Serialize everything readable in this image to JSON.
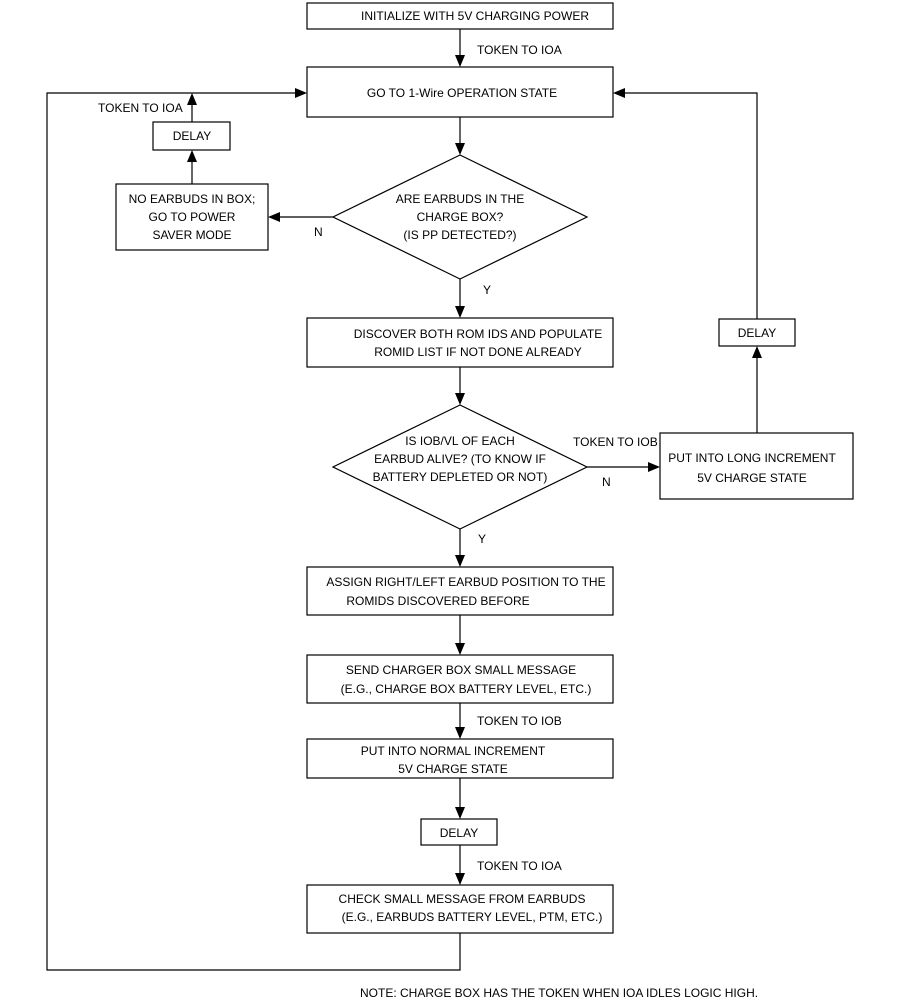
{
  "nodes": {
    "init": {
      "lines": [
        "INITIALIZE WITH 5V CHARGING POWER"
      ]
    },
    "one_wire": {
      "lines": [
        "GO TO 1-Wire OPERATION STATE"
      ]
    },
    "decision_earbuds": {
      "lines": [
        "ARE EARBUDS IN THE",
        "CHARGE BOX?",
        "(IS PP DETECTED?)"
      ]
    },
    "power_saver": {
      "lines": [
        "NO EARBUDS IN BOX;",
        "GO TO POWER",
        "SAVER MODE"
      ]
    },
    "delay_left": {
      "lines": [
        "DELAY"
      ]
    },
    "discover": {
      "lines": [
        "DISCOVER BOTH ROM IDS AND POPULATE",
        "ROMID LIST IF NOT DONE ALREADY"
      ]
    },
    "decision_alive": {
      "lines": [
        "IS IOB/VL OF EACH",
        "EARBUD ALIVE? (TO KNOW IF",
        "BATTERY DEPLETED OR NOT)"
      ]
    },
    "long_increment": {
      "lines": [
        "PUT INTO LONG INCREMENT",
        "5V CHARGE STATE"
      ]
    },
    "delay_right": {
      "lines": [
        "DELAY"
      ]
    },
    "assign": {
      "lines": [
        "ASSIGN RIGHT/LEFT EARBUD POSITION TO THE",
        "ROMIDS DISCOVERED BEFORE"
      ]
    },
    "send_msg": {
      "lines": [
        "SEND CHARGER BOX SMALL MESSAGE",
        "(E.G., CHARGE BOX BATTERY LEVEL, ETC.)"
      ]
    },
    "normal_increment": {
      "lines": [
        "PUT INTO NORMAL INCREMENT",
        "5V CHARGE STATE"
      ]
    },
    "delay_bottom": {
      "lines": [
        "DELAY"
      ]
    },
    "check_msg": {
      "lines": [
        "CHECK SMALL MESSAGE FROM EARBUDS",
        "(E.G., EARBUDS BATTERY LEVEL, PTM, ETC.)"
      ]
    }
  },
  "edge_labels": {
    "init_to_onewire": "TOKEN TO IOA",
    "delay_left_up": "TOKEN TO IOA",
    "earbuds_no": "N",
    "earbuds_yes": "Y",
    "alive_no_token": "TOKEN TO IOB",
    "alive_no": "N",
    "alive_yes": "Y",
    "send_to_normal": "TOKEN TO IOB",
    "delay_to_check": "TOKEN TO IOA"
  },
  "note": "NOTE: CHARGE BOX HAS THE TOKEN WHEN IOA IDLES LOGIC HIGH."
}
